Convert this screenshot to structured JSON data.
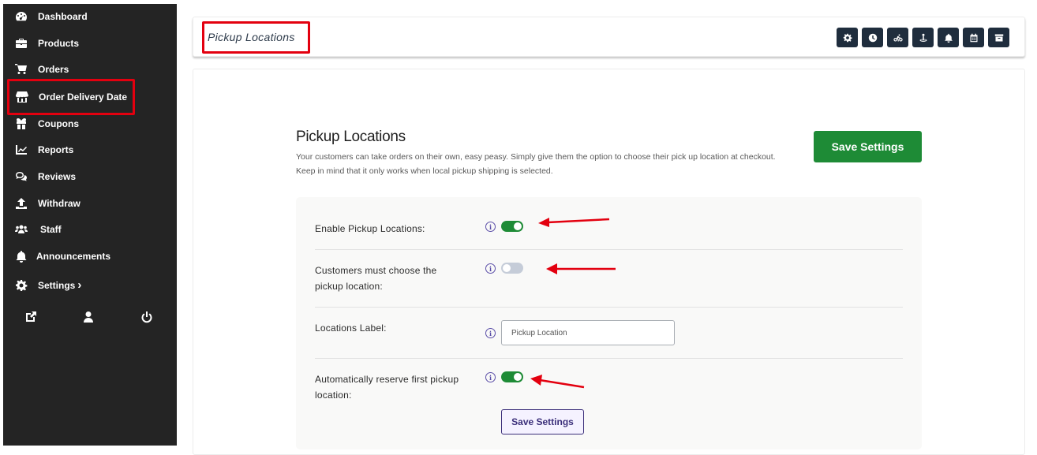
{
  "sidebar": {
    "items": [
      {
        "label": "Dashboard",
        "icon": "dashboard-icon"
      },
      {
        "label": "Products",
        "icon": "briefcase-icon"
      },
      {
        "label": "Orders",
        "icon": "cart-icon"
      },
      {
        "label": "Order Delivery Date",
        "icon": "store-icon"
      },
      {
        "label": "Coupons",
        "icon": "gift-icon"
      },
      {
        "label": "Reports",
        "icon": "chart-icon"
      },
      {
        "label": "Reviews",
        "icon": "comments-icon"
      },
      {
        "label": "Withdraw",
        "icon": "upload-icon"
      },
      {
        "label": "Staff",
        "icon": "users-icon"
      },
      {
        "label": "Announcements",
        "icon": "bell-icon"
      },
      {
        "label": "Settings",
        "icon": "gear-icon",
        "chevron": "›"
      }
    ],
    "bottom_icons": [
      "external-link-icon",
      "user-icon",
      "power-icon"
    ]
  },
  "header": {
    "title": "Pickup Locations",
    "tool_buttons": [
      "gear-icon",
      "clock-icon",
      "bicycle-icon",
      "map-pin-icon",
      "bell-icon",
      "calendar-icon",
      "archive-icon"
    ]
  },
  "main": {
    "title": "Pickup Locations",
    "description": "Your customers can take orders on their own, easy peasy. Simply give them the option to choose their pick up location at checkout. Keep in mind that it only works when local pickup shipping is selected.",
    "save_label": "Save Settings",
    "settings": [
      {
        "label": "Enable Pickup Locations:",
        "type": "toggle",
        "value": true
      },
      {
        "label": "Customers must choose the pickup location:",
        "type": "toggle",
        "value": false
      },
      {
        "label": "Locations Label:",
        "type": "text",
        "value": "Pickup Location"
      },
      {
        "label": "Automatically reserve first pickup location:",
        "type": "toggle",
        "value": true
      }
    ],
    "bottom_save_label": "Save Settings"
  },
  "colors": {
    "sidebar_bg": "#242424",
    "accent_green": "#1e8b36",
    "toggle_off": "#c5ccd8",
    "purple": "#3b2f7a",
    "annotation_red": "#e3000f",
    "toolbar_button": "#1f2d3d"
  }
}
